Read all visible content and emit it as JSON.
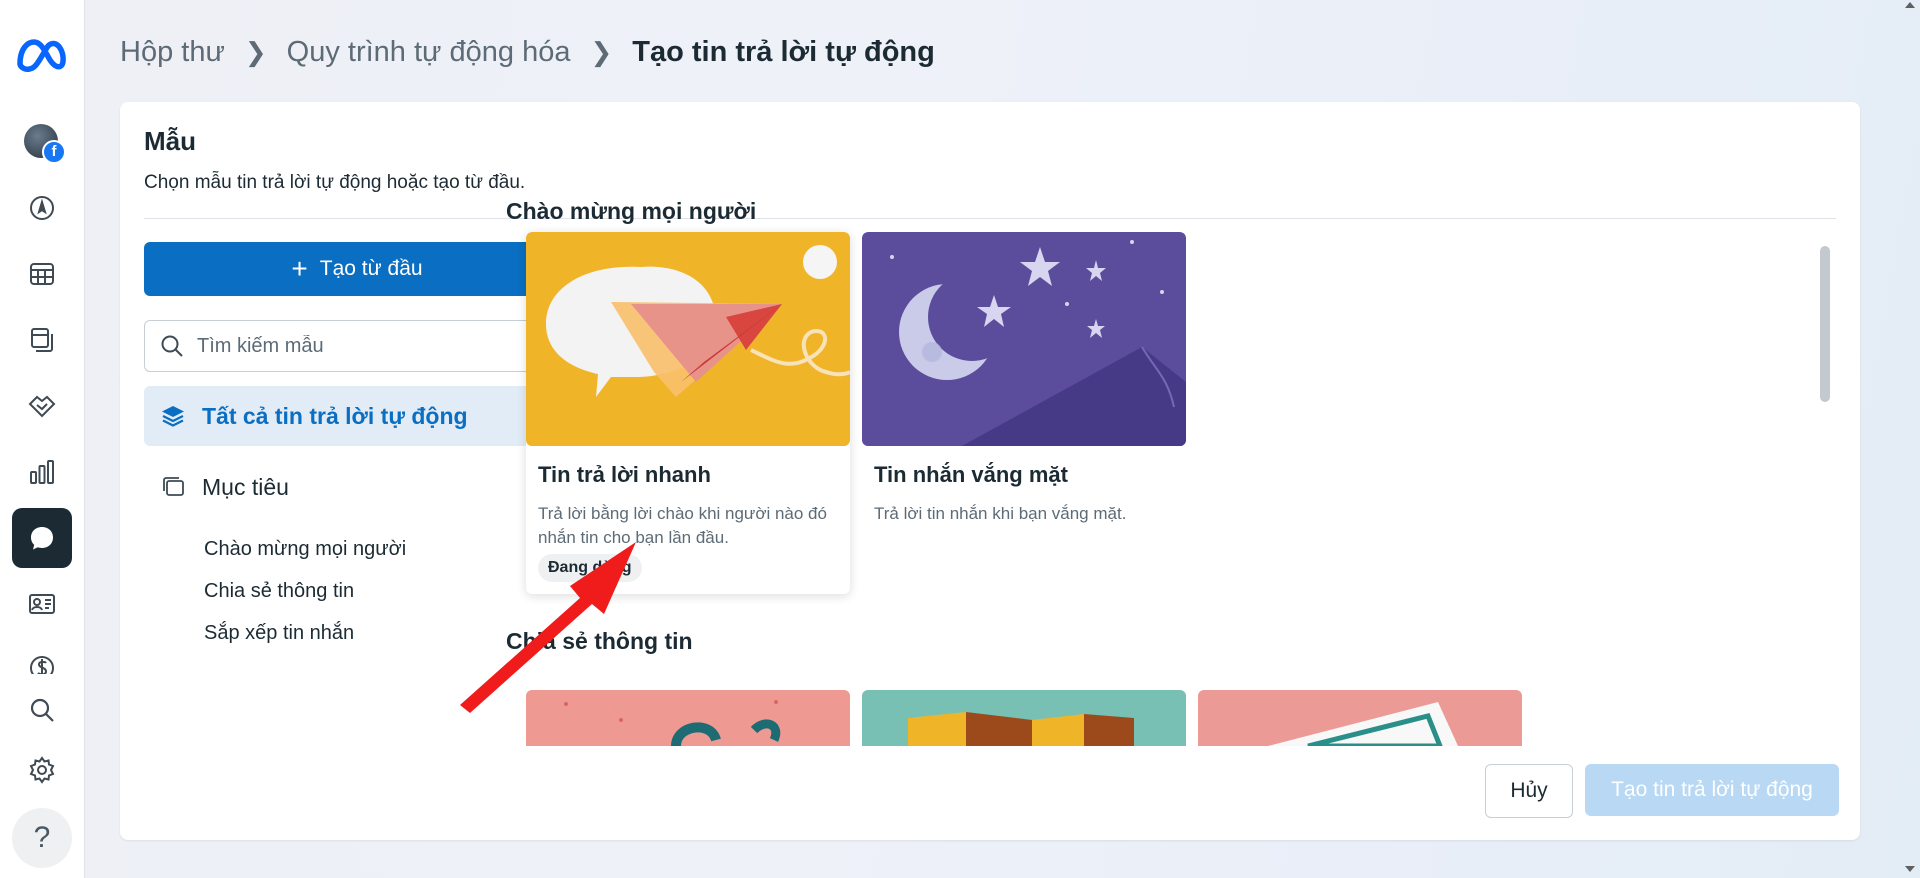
{
  "breadcrumb": [
    "Hộp thư",
    "Quy trình tự động hóa",
    "Tạo tin trả lời tự động"
  ],
  "panel": {
    "title": "Mẫu",
    "subtitle": "Chọn mẫu tin trả lời tự động hoặc tạo từ đầu."
  },
  "sidebar": {
    "create_label": "Tạo từ đầu",
    "search_placeholder": "Tìm kiếm mẫu",
    "all_label": "Tất cả tin trả lời tự động",
    "goals_label": "Mục tiêu",
    "goals": [
      "Chào mừng mọi người",
      "Chia sẻ thông tin",
      "Sắp xếp tin nhắn"
    ]
  },
  "sections": [
    {
      "title": "Chào mừng mọi người",
      "cards": [
        {
          "title": "Tin trả lời nhanh",
          "description": "Trả lời bằng lời chào khi người nào đó nhắn tin cho bạn lần đầu.",
          "badge": "Đang dùng",
          "image": "paper-plane-chat-illustration",
          "color": "#f0b429"
        },
        {
          "title": "Tin nhắn vắng mặt",
          "description": "Trả lời tin nhắn khi bạn vắng mặt.",
          "image": "moon-stars-illustration",
          "color": "#5b4d9c"
        }
      ]
    },
    {
      "title": "Chia sẻ thông tin",
      "cards": [
        {
          "image": "pink-illustration",
          "color": "#ee9a93"
        },
        {
          "image": "map-illustration",
          "color": "#78c0b3"
        },
        {
          "image": "card-illustration",
          "color": "#ec9a96"
        }
      ]
    }
  ],
  "footer": {
    "cancel_label": "Hủy",
    "submit_label": "Tạo tin trả lời tự động"
  },
  "colors": {
    "primary": "#0a6fc2",
    "primary_disabled": "#b8d8f3",
    "active_nav_bg": "#e2ecf6",
    "annotation_arrow": "#f01c1c"
  }
}
